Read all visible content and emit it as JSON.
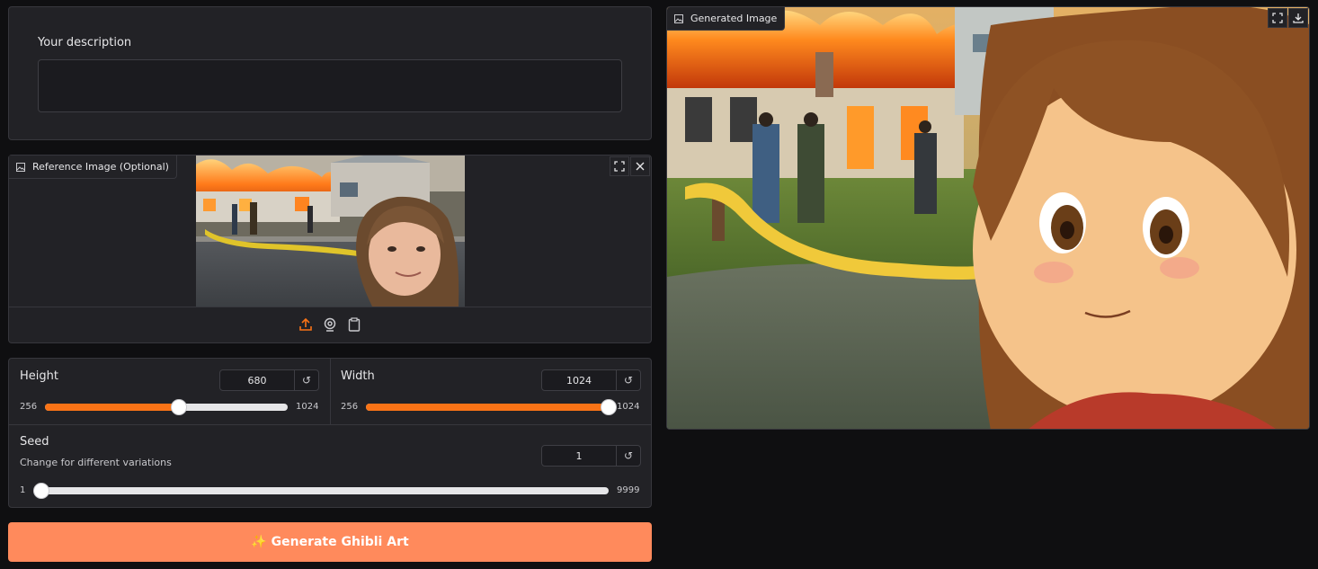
{
  "description": {
    "label": "Your description",
    "value": ""
  },
  "reference": {
    "label": "Reference Image (Optional)",
    "icons": [
      "image-icon",
      "fullscreen-icon",
      "close-icon",
      "upload-icon",
      "webcam-icon",
      "clipboard-icon"
    ]
  },
  "height": {
    "label": "Height",
    "value": "680",
    "min": "256",
    "max": "1024",
    "fraction": 0.553,
    "reset": "↺"
  },
  "width": {
    "label": "Width",
    "value": "1024",
    "min": "256",
    "max": "1024",
    "fraction": 1.0,
    "reset": "↺"
  },
  "seed": {
    "label": "Seed",
    "info": "Change for different variations",
    "value": "1",
    "min": "1",
    "max": "9999",
    "fraction": 0.0,
    "reset": "↺"
  },
  "generate_button": {
    "label": "✨ Generate Ghibli Art"
  },
  "output": {
    "label": "Generated Image",
    "icons": [
      "fullscreen-icon",
      "download-icon"
    ]
  },
  "colors": {
    "accent": "#f97316",
    "button": "#ff8a5c",
    "panel": "#222226",
    "background": "#0f0f11"
  }
}
